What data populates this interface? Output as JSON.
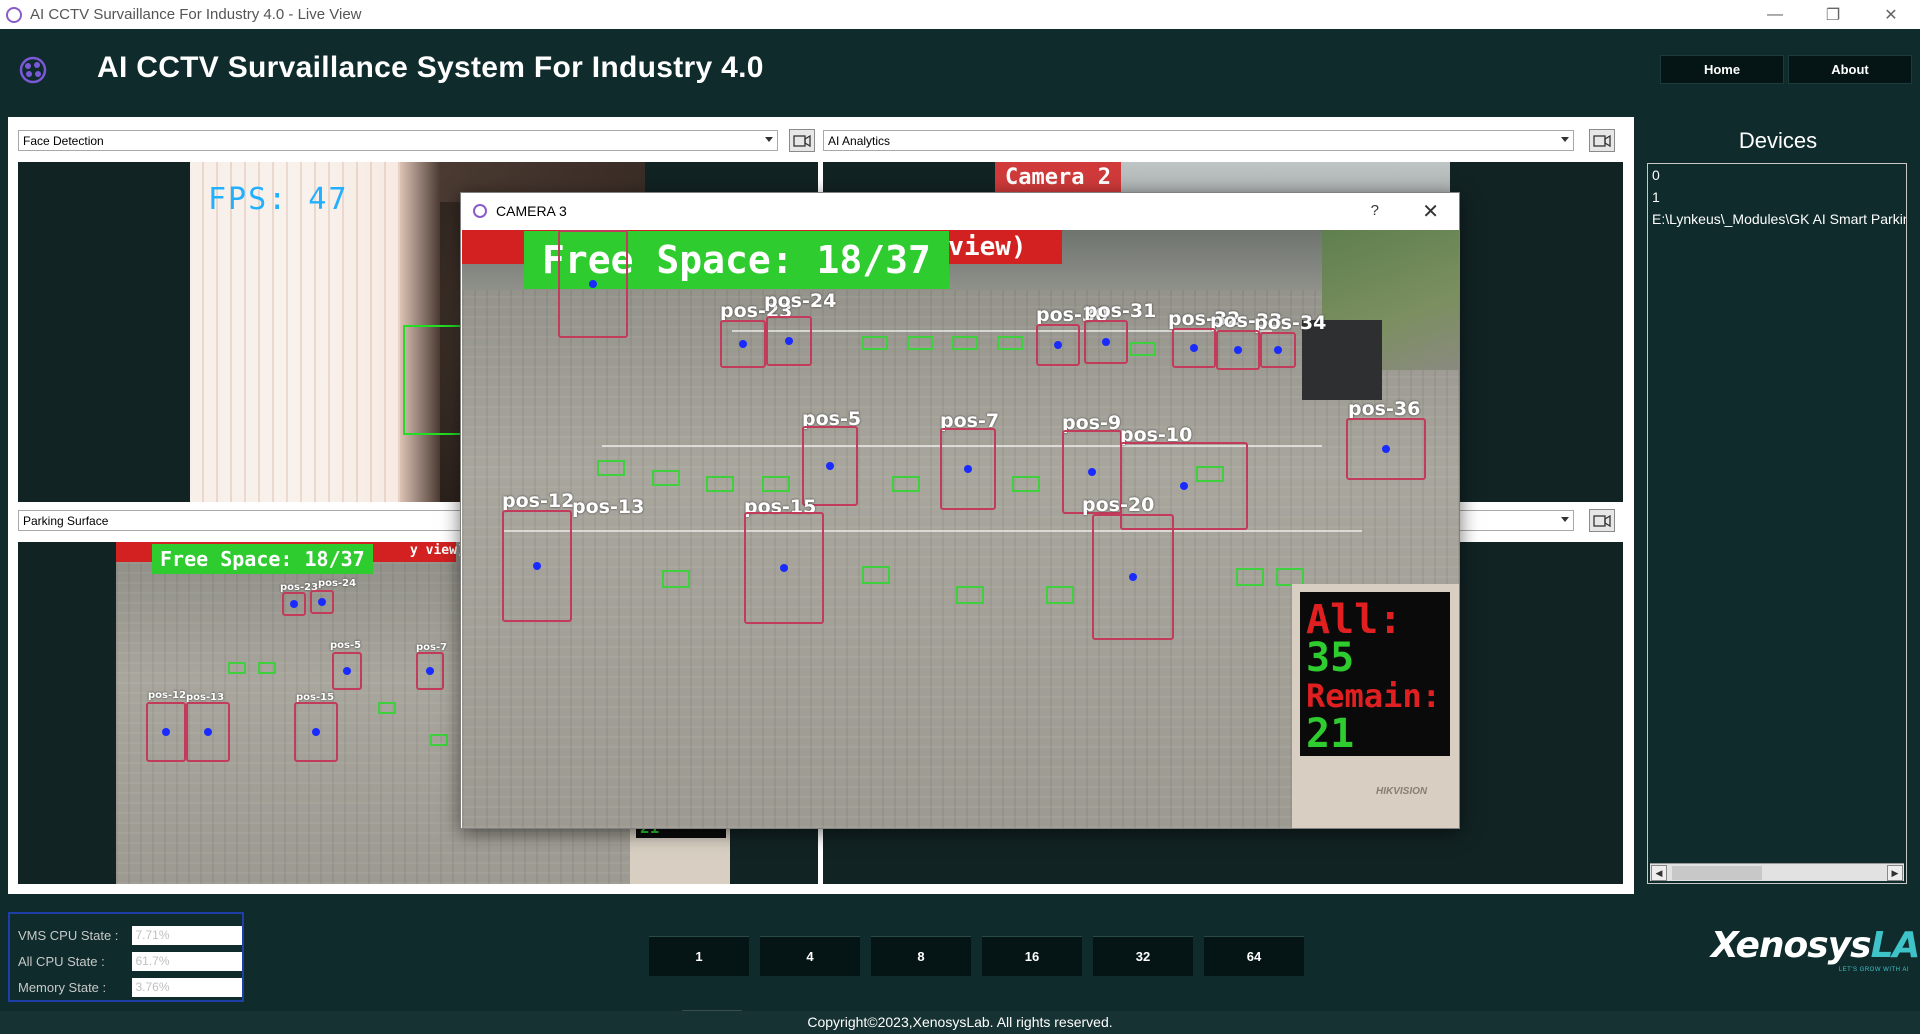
{
  "window": {
    "title": "AI CCTV Survaillance For Industry 4.0 - Live View",
    "controls": [
      "—",
      "❐",
      "✕"
    ]
  },
  "header": {
    "title": "AI CCTV Survaillance System For Industry 4.0",
    "nav": {
      "home": "Home",
      "about": "About"
    }
  },
  "views": {
    "top_left": {
      "selected": "Face Detection",
      "fps": "FPS: 47"
    },
    "top_right": {
      "selected": "AI Analytics",
      "camera_label": "Camera 2"
    },
    "bottom_left": {
      "selected": "Parking Surface",
      "free_space": "Free Space: 18/37",
      "strip_text": "y view)",
      "positions": [
        "pos-23",
        "pos-24",
        "pos-5",
        "pos-7",
        "pos-12",
        "pos-13",
        "pos-15"
      ],
      "sign_value": "21"
    },
    "bottom_right": {
      "selected": ""
    }
  },
  "dialog": {
    "title": "CAMERA 3",
    "help": "?",
    "close": "✕",
    "free_space": "Free Space: 18/37",
    "strip_text": "y view)",
    "positions": [
      "pos-23",
      "pos-24",
      "pos-30",
      "pos-31",
      "pos-32",
      "pos-33",
      "pos-34",
      "pos-5",
      "pos-7",
      "pos-9",
      "pos-10",
      "pos-36",
      "pos-12",
      "pos-13",
      "pos-15",
      "pos-20"
    ],
    "sign": {
      "all_label": "All:",
      "all_value": "35",
      "remain_label": "Remain:",
      "remain_value": "21",
      "brand": "HIKVISION"
    }
  },
  "devices": {
    "title": "Devices",
    "items": [
      "0",
      "1",
      "E:\\Lynkeus\\_Modules\\GK AI Smart Parking"
    ],
    "scroll": {
      "left": "◀",
      "right": "▶"
    }
  },
  "status": {
    "vms_cpu": {
      "label": "VMS CPU State :",
      "value": "7.71%"
    },
    "all_cpu": {
      "label": "All CPU State   :",
      "value": "61.7%"
    },
    "memory": {
      "label": "Memory State  :",
      "value": "3.76%"
    }
  },
  "grid_buttons": [
    "1",
    "4",
    "8",
    "16",
    "32",
    "64"
  ],
  "brand": {
    "name_a": "Xenosys",
    "name_b": "LAB",
    "tagline": "LET'S GROW WITH AI"
  },
  "footer": {
    "copyright": "Copyright©2023,XenosysLab. All rights reserved."
  },
  "colors": {
    "background": "#0f2b2c",
    "accent": "#3ec3c9",
    "free_space": "#2fcc2f",
    "alert": "#d32020",
    "detection_box": "#c23b5a"
  }
}
